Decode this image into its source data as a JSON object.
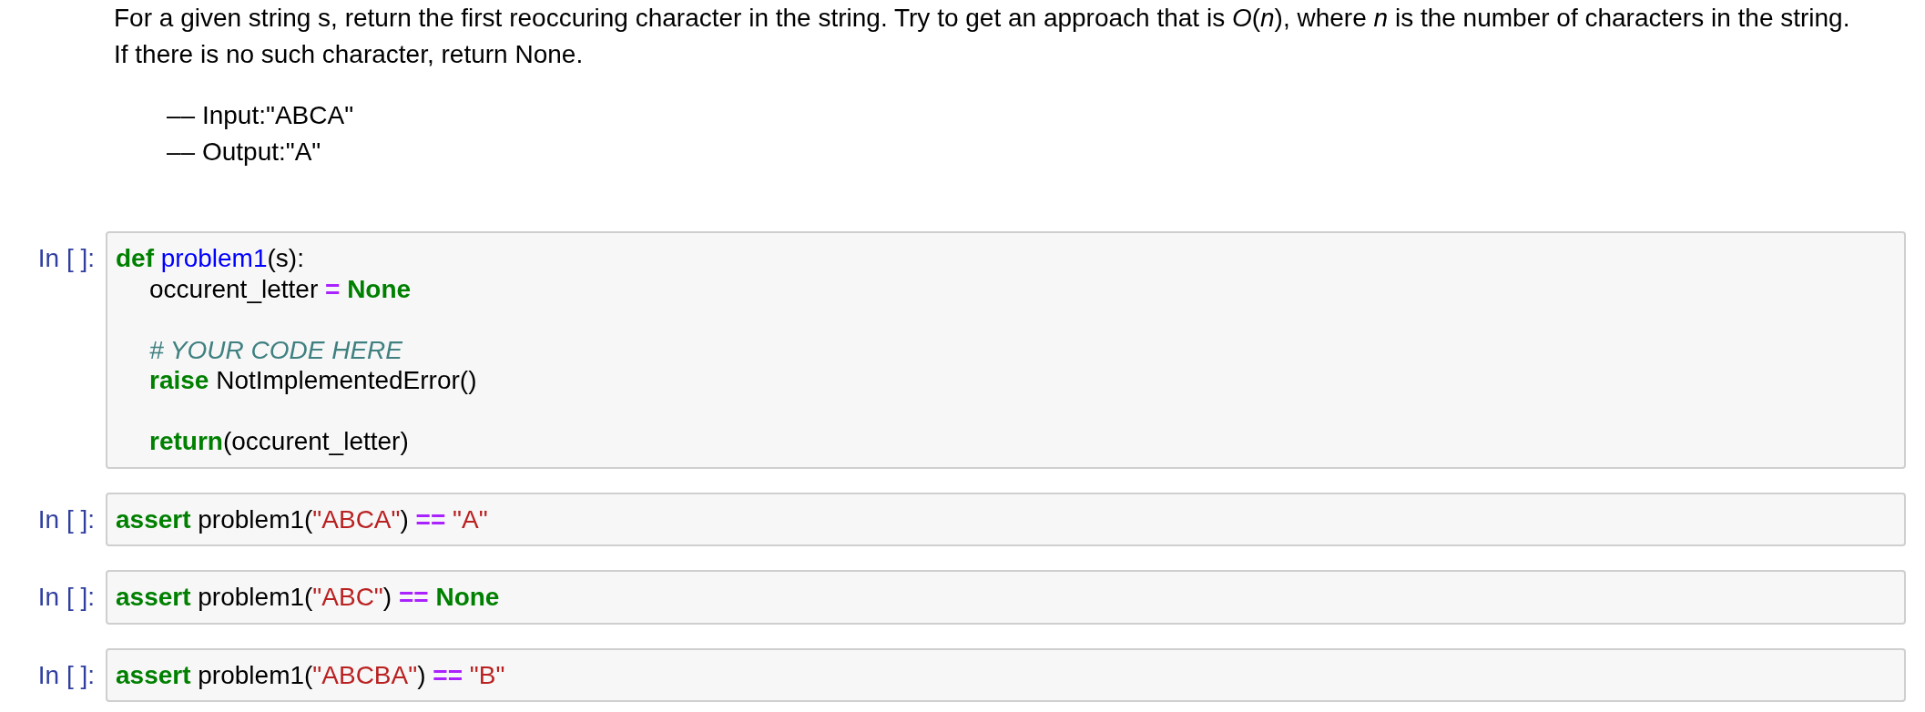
{
  "markdown": {
    "lines": [
      "For a given string s, return the first reoccuring character in the string. Try to get an approach that is *O*(*n*), where *n* is the number of characters in the string.",
      "If there is no such character, return None."
    ],
    "examples": [
      "–– Input:\"ABCA\"",
      "–– Output:\"A\""
    ]
  },
  "cells": [
    {
      "prompt": "In [ ]:",
      "lines": [
        {
          "kind": "code",
          "tokens": [
            {
              "kind": "keyword",
              "text": "def"
            },
            {
              "kind": "function",
              "text": " problem1"
            },
            {
              "kind": "plain",
              "text": "(s):"
            }
          ],
          "children": [
            {
              "kind": "code",
              "tokens": [
                {
                  "kind": "plain",
                  "text": "occurent_letter "
                },
                {
                  "kind": "operator",
                  "text": "="
                },
                {
                  "kind": "keyword",
                  "text": " None"
                }
              ]
            },
            {
              "kind": "blank"
            },
            {
              "kind": "code",
              "tokens": [
                {
                  "kind": "comment",
                  "text": "# YOUR CODE HERE"
                }
              ]
            },
            {
              "kind": "code",
              "tokens": [
                {
                  "kind": "keyword",
                  "text": "raise"
                },
                {
                  "kind": "plain",
                  "text": " NotImplementedError()"
                }
              ]
            },
            {
              "kind": "blank"
            },
            {
              "kind": "code",
              "tokens": [
                {
                  "kind": "keyword",
                  "text": "return"
                },
                {
                  "kind": "plain",
                  "text": "(occurent_letter)"
                }
              ]
            }
          ]
        }
      ]
    },
    {
      "prompt": "In [ ]:",
      "lines": [
        {
          "kind": "code",
          "tokens": [
            {
              "kind": "keyword",
              "text": "assert"
            },
            {
              "kind": "plain",
              "text": " problem1("
            },
            {
              "kind": "string",
              "text": "\"ABCA\""
            },
            {
              "kind": "plain",
              "text": ") "
            },
            {
              "kind": "operator",
              "text": "=="
            },
            {
              "kind": "string",
              "text": " \"A\""
            }
          ]
        }
      ]
    },
    {
      "prompt": "In [ ]:",
      "lines": [
        {
          "kind": "code",
          "tokens": [
            {
              "kind": "keyword",
              "text": "assert"
            },
            {
              "kind": "plain",
              "text": " problem1("
            },
            {
              "kind": "string",
              "text": "\"ABC\""
            },
            {
              "kind": "plain",
              "text": ") "
            },
            {
              "kind": "operator",
              "text": "=="
            },
            {
              "kind": "keyword",
              "text": " None"
            }
          ]
        }
      ]
    },
    {
      "prompt": "In [ ]:",
      "lines": [
        {
          "kind": "code",
          "tokens": [
            {
              "kind": "keyword",
              "text": "assert"
            },
            {
              "kind": "plain",
              "text": " problem1("
            },
            {
              "kind": "string",
              "text": "\"ABCBA\""
            },
            {
              "kind": "plain",
              "text": ") "
            },
            {
              "kind": "operator",
              "text": "=="
            },
            {
              "kind": "string",
              "text": " \"B\""
            }
          ]
        }
      ]
    }
  ]
}
